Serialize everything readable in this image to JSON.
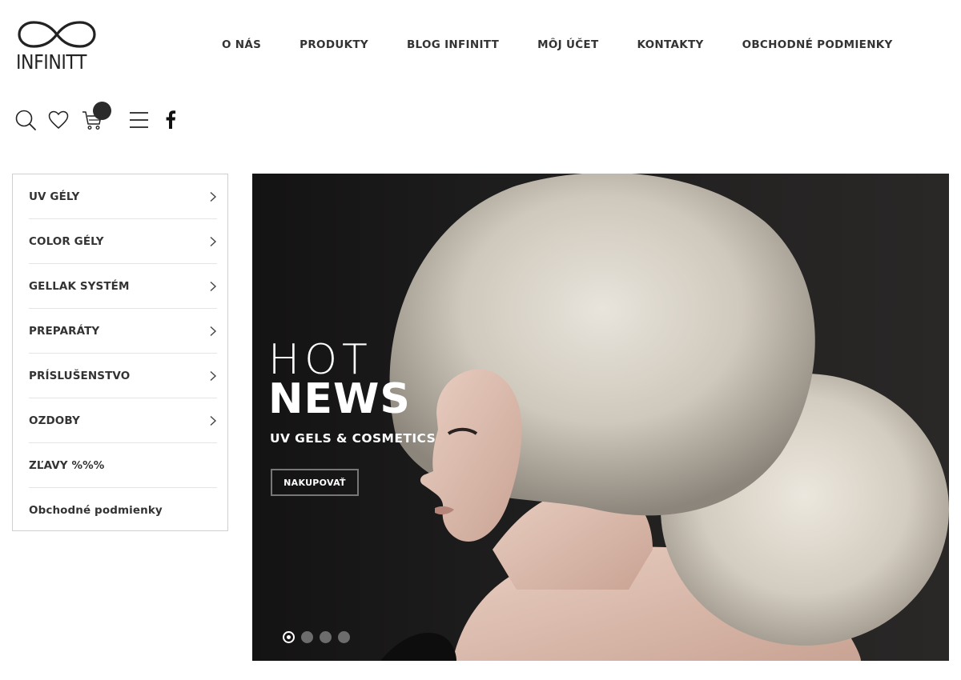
{
  "brand": {
    "name": "INFINITT"
  },
  "topnav": [
    {
      "label": "O NÁS"
    },
    {
      "label": "PRODUKTY"
    },
    {
      "label": "BLOG INFINITT"
    },
    {
      "label": "MÔJ ÚČET"
    },
    {
      "label": "KONTAKTY"
    },
    {
      "label": "OBCHODNÉ PODMIENKY"
    }
  ],
  "icons": [
    "search-icon",
    "heart-icon",
    "cart-icon",
    "menu-icon",
    "facebook-icon"
  ],
  "sidebar": {
    "items": [
      {
        "label": "UV GÉLY",
        "has_submenu": true
      },
      {
        "label": "COLOR GÉLY",
        "has_submenu": true
      },
      {
        "label": "GELLAK SYSTÉM",
        "has_submenu": true
      },
      {
        "label": "PREPARÁTY",
        "has_submenu": true
      },
      {
        "label": "PRÍSLUŠENSTVO",
        "has_submenu": true
      },
      {
        "label": "OZDOBY",
        "has_submenu": true
      },
      {
        "label": "ZĽAVY %%%",
        "has_submenu": false
      },
      {
        "label": "Obchodné podmienky",
        "has_submenu": false
      }
    ]
  },
  "hero": {
    "title_light": "HOT",
    "title_bold": "NEWS",
    "subtitle": "UV GELS & COSMETICS",
    "button_label": "NAKUPOVAŤ",
    "slides": 4,
    "active_slide": 1
  },
  "colors": {
    "text": "#333333",
    "hero_bg": "#1b1a1a",
    "badge": "#2b2b2b"
  }
}
